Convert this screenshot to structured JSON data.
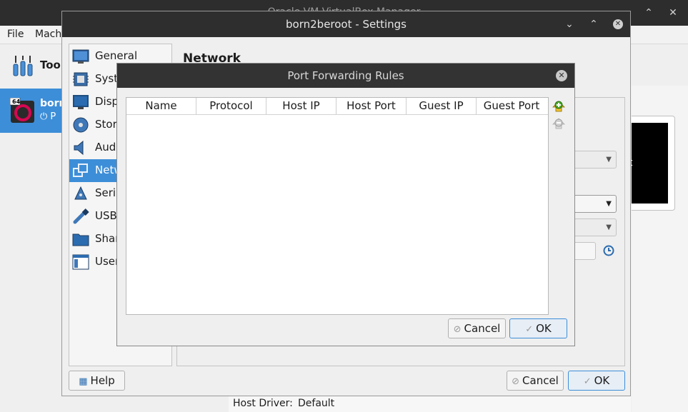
{
  "main": {
    "title": "Oracle VM VirtualBox Manager",
    "menu": [
      "File",
      "Mach"
    ],
    "tools_label": "Tool",
    "vm_name": "born",
    "vm_state": "P",
    "vm_badge": "64",
    "host_driver_label": "Host Driver:",
    "host_driver_value": "Default",
    "preview_text": "t"
  },
  "settings": {
    "title": "born2beroot - Settings",
    "page_title": "Network",
    "nav": [
      {
        "label": "General",
        "icon": "general-icon"
      },
      {
        "label": "Syste",
        "icon": "system-icon"
      },
      {
        "label": "Disp",
        "icon": "display-icon"
      },
      {
        "label": "Stora",
        "icon": "storage-icon"
      },
      {
        "label": "Audi",
        "icon": "audio-icon"
      },
      {
        "label": "Netw",
        "icon": "network-icon",
        "selected": true
      },
      {
        "label": "Seria",
        "icon": "serial-icon"
      },
      {
        "label": "USB",
        "icon": "usb-icon"
      },
      {
        "label": "Shar",
        "icon": "shared-folders-icon"
      },
      {
        "label": "User",
        "icon": "user-interface-icon"
      }
    ],
    "help_label": "Help",
    "cancel_label": "Cancel",
    "ok_label": "OK"
  },
  "port_forwarding": {
    "title": "Port Forwarding Rules",
    "columns": [
      "Name",
      "Protocol",
      "Host IP",
      "Host Port",
      "Guest IP",
      "Guest Port"
    ],
    "rows": [],
    "cancel_label": "Cancel",
    "ok_label": "OK"
  },
  "colors": {
    "accent": "#3d8ed8",
    "titlebar": "#2e2e2e",
    "add_icon": "#4caf2a"
  }
}
